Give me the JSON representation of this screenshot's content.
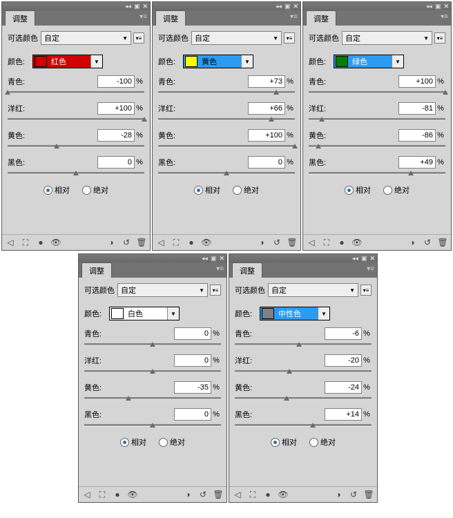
{
  "common": {
    "tab_label": "调整",
    "preset_label": "可选颜色",
    "preset_value": "自定",
    "color_label": "颜色:",
    "pct": "%",
    "channels": {
      "cyan": "青色:",
      "magenta": "洋红:",
      "yellow": "黄色:",
      "black": "黑色:"
    },
    "mode": {
      "relative": "相对",
      "absolute": "绝对"
    }
  },
  "panels": [
    {
      "color_name": "红色",
      "swatch": "#d00000",
      "bg": "#d00000",
      "name_color": "light",
      "cyan": -100,
      "magenta": 100,
      "yellow": -28,
      "black": 0
    },
    {
      "color_name": "黄色",
      "swatch": "#ffff00",
      "bg": "#2a9cf4",
      "name_color": "dark",
      "cyan": 73,
      "magenta": 66,
      "yellow": 100,
      "black": 0
    },
    {
      "color_name": "绿色",
      "swatch": "#007f00",
      "bg": "#2a9cf4",
      "name_color": "light",
      "cyan": 100,
      "magenta": -81,
      "yellow": -86,
      "black": 49
    },
    {
      "color_name": "白色",
      "swatch": "#ffffff",
      "bg": "#ffffff",
      "name_color": "dark",
      "cyan": 0,
      "magenta": 0,
      "yellow": -35,
      "black": 0
    },
    {
      "color_name": "中性色",
      "swatch": "#808080",
      "bg": "#2a9cf4",
      "name_color": "light",
      "cyan": -6,
      "magenta": -20,
      "yellow": -24,
      "black": 14
    }
  ]
}
